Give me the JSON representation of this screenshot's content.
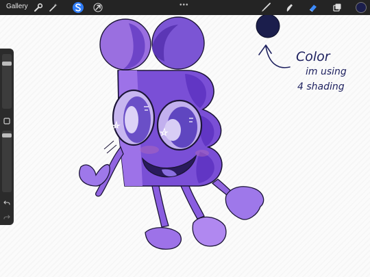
{
  "toolbar": {
    "gallery_label": "Gallery",
    "more_label": "•••",
    "left_tools": [
      "wrench-icon",
      "magic-wand-icon",
      "selection-icon",
      "transform-arrow-icon"
    ],
    "right_tools": [
      "brush-icon",
      "smudge-icon",
      "eraser-icon",
      "layers-icon"
    ]
  },
  "colors": {
    "current_color": "#1b1e4c",
    "selection_accent": "#2f7cf6",
    "eraser_accent": "#3d8cff"
  },
  "annotation": {
    "line1": "Color",
    "line2": "im using",
    "line3": "4 shading"
  },
  "sidebar": {
    "brush_size_level": 0.85,
    "opacity_level": 0.95
  }
}
